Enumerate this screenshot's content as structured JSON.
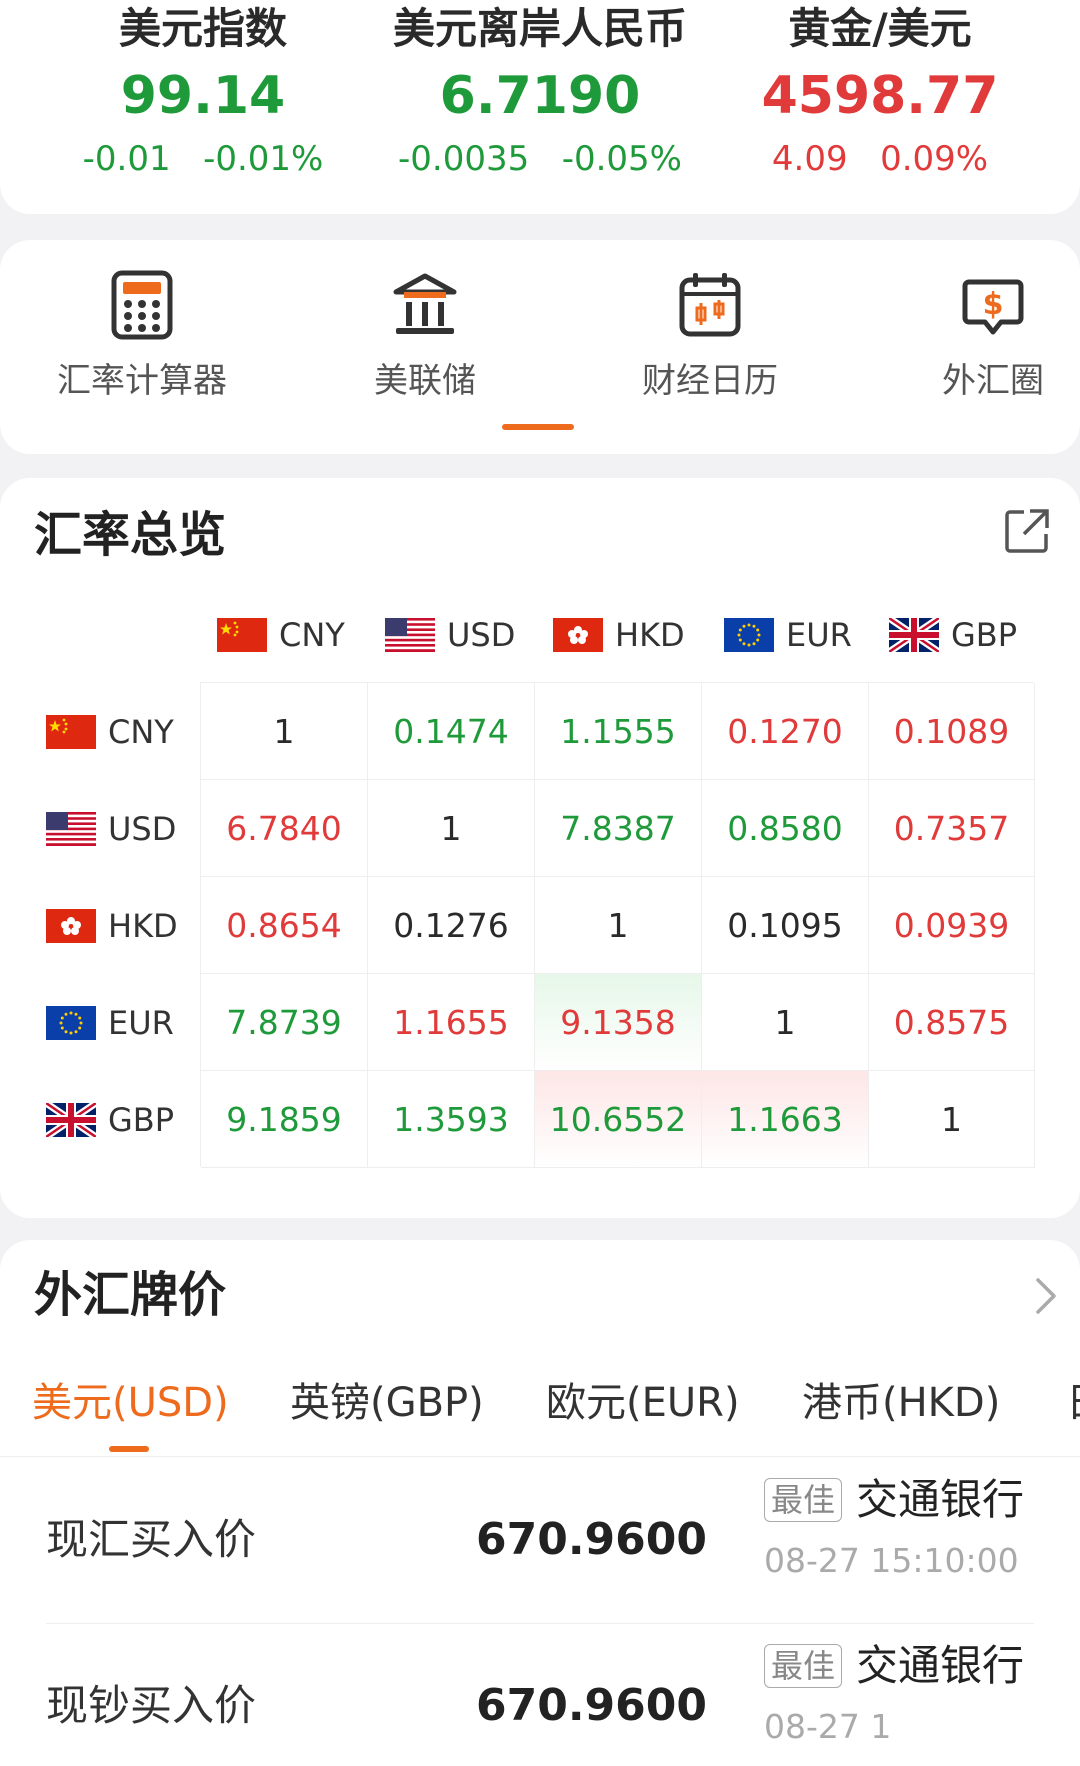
{
  "tickers": [
    {
      "name": "美元指数",
      "value": "99.14",
      "change": "-0.01",
      "pct": "-0.01%",
      "trend": "down"
    },
    {
      "name": "美元离岸人民币",
      "value": "6.7190",
      "change": "-0.0035",
      "pct": "-0.05%",
      "trend": "down"
    },
    {
      "name": "黄金/美元",
      "value": "4598.77",
      "change": "4.09",
      "pct": "0.09%",
      "trend": "up"
    }
  ],
  "tools": [
    {
      "label": "汇率计算器",
      "icon": "calculator-icon"
    },
    {
      "label": "美联储",
      "icon": "bank-building-icon"
    },
    {
      "label": "财经日历",
      "icon": "calendar-chart-icon"
    },
    {
      "label": "外汇圈",
      "icon": "dollar-chat-icon"
    }
  ],
  "overview": {
    "title": "汇率总览",
    "currencies": [
      "CNY",
      "USD",
      "HKD",
      "EUR",
      "GBP"
    ],
    "rows": [
      {
        "code": "CNY",
        "cells": [
          {
            "v": "1",
            "c": "dark"
          },
          {
            "v": "0.1474",
            "c": "green"
          },
          {
            "v": "1.1555",
            "c": "green"
          },
          {
            "v": "0.1270",
            "c": "red"
          },
          {
            "v": "0.1089",
            "c": "red"
          }
        ]
      },
      {
        "code": "USD",
        "cells": [
          {
            "v": "6.7840",
            "c": "red"
          },
          {
            "v": "1",
            "c": "dark"
          },
          {
            "v": "7.8387",
            "c": "green"
          },
          {
            "v": "0.8580",
            "c": "green"
          },
          {
            "v": "0.7357",
            "c": "red"
          }
        ]
      },
      {
        "code": "HKD",
        "cells": [
          {
            "v": "0.8654",
            "c": "red"
          },
          {
            "v": "0.1276",
            "c": "dark"
          },
          {
            "v": "1",
            "c": "dark"
          },
          {
            "v": "0.1095",
            "c": "dark"
          },
          {
            "v": "0.0939",
            "c": "red"
          }
        ]
      },
      {
        "code": "EUR",
        "cells": [
          {
            "v": "7.8739",
            "c": "green"
          },
          {
            "v": "1.1655",
            "c": "red"
          },
          {
            "v": "9.1358",
            "c": "red",
            "hl": "green"
          },
          {
            "v": "1",
            "c": "dark"
          },
          {
            "v": "0.8575",
            "c": "red"
          }
        ]
      },
      {
        "code": "GBP",
        "cells": [
          {
            "v": "9.1859",
            "c": "green"
          },
          {
            "v": "1.3593",
            "c": "green"
          },
          {
            "v": "10.6552",
            "c": "green",
            "hl": "red"
          },
          {
            "v": "1.1663",
            "c": "green",
            "hl": "red"
          },
          {
            "v": "1",
            "c": "dark"
          }
        ]
      }
    ]
  },
  "quotes": {
    "title": "外汇牌价",
    "tabs": [
      "美元(USD)",
      "英镑(GBP)",
      "欧元(EUR)",
      "港币(HKD)",
      "日"
    ],
    "active_tab": 0,
    "items": [
      {
        "label": "现汇买入价",
        "value": "670.9600",
        "badge": "最佳",
        "bank": "交通银行",
        "time": "08-27 15:10:00"
      },
      {
        "label": "现钞买入价",
        "value": "670.9600",
        "badge": "最佳",
        "bank": "交通银行",
        "time": "08-27 1"
      }
    ]
  },
  "colors": {
    "green": "#1f9a3a",
    "red": "#e03a3a",
    "accent": "#ee6a1d"
  }
}
